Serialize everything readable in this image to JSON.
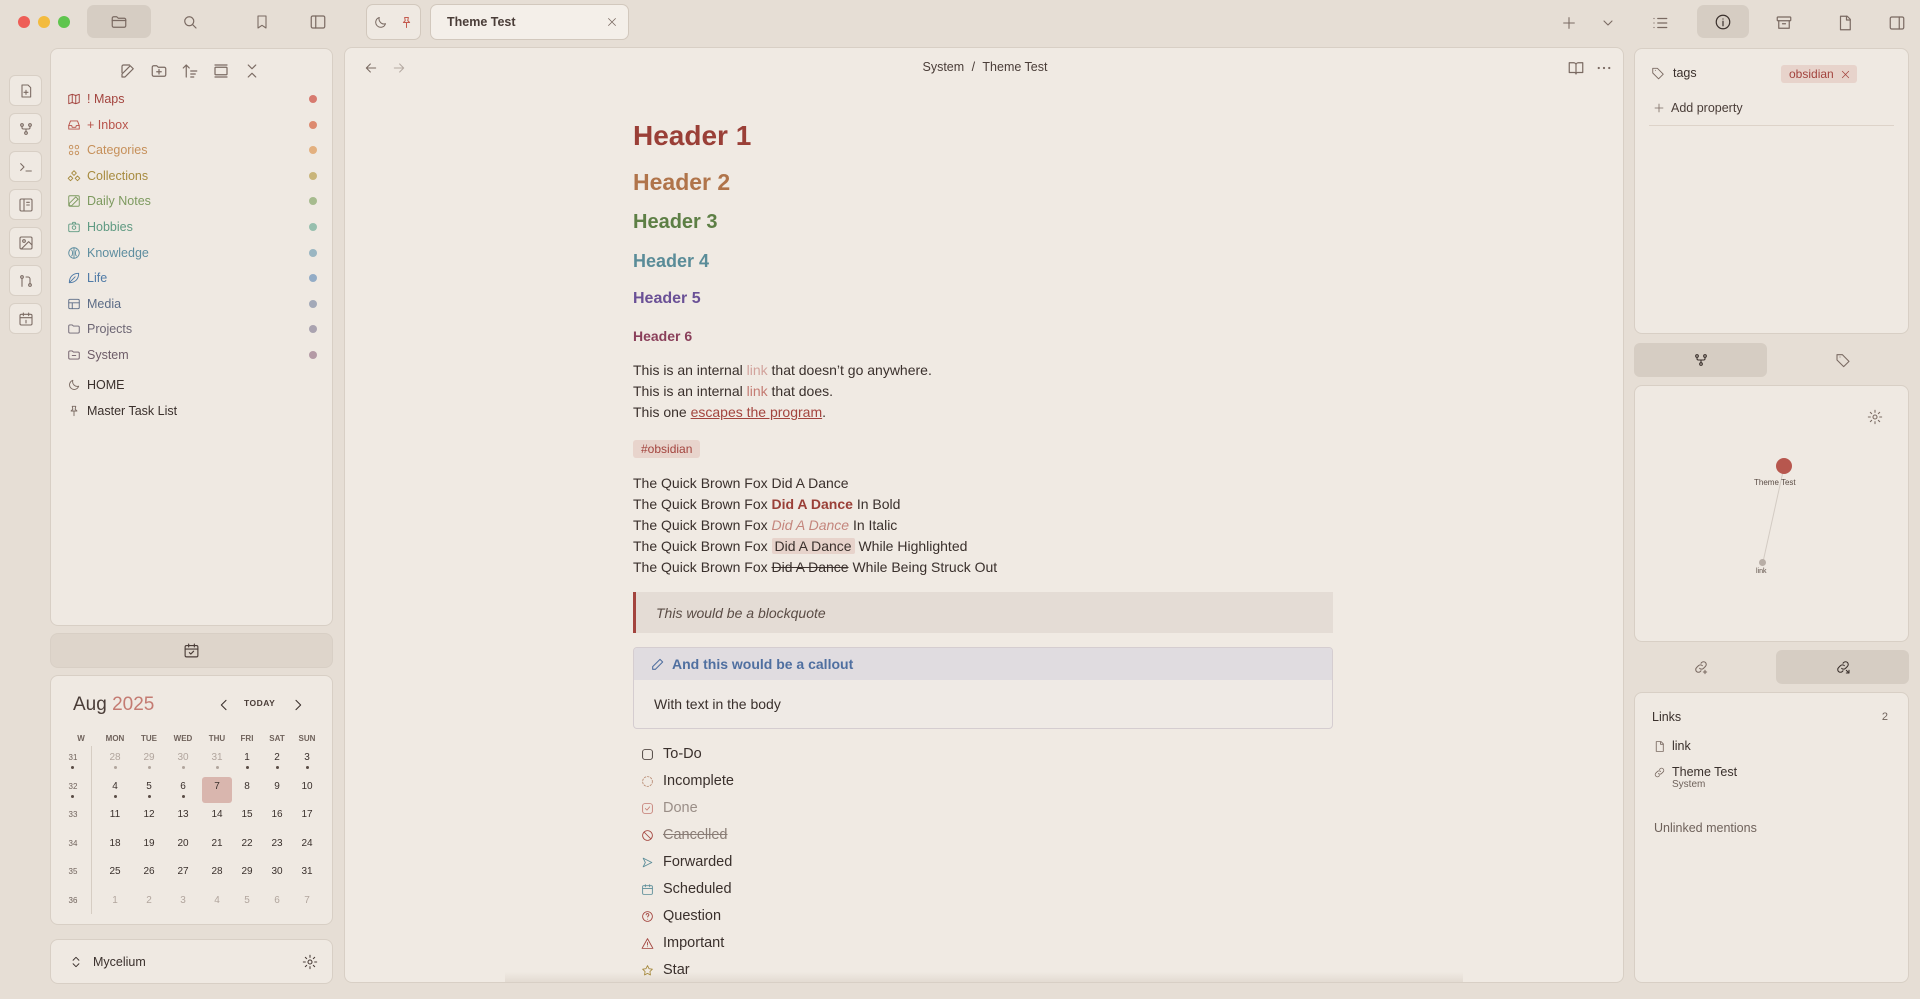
{
  "titlebar": {
    "tab_title": "Theme Test"
  },
  "left_sidebar": {
    "folders": [
      {
        "label": "! Maps",
        "color": "#a3443e",
        "dot": "#d77a6f"
      },
      {
        "label": "+ Inbox",
        "color": "#b8534a",
        "dot": "#dd8a6f"
      },
      {
        "label": "Categories",
        "color": "#c6905a",
        "dot": "#e3b07f"
      },
      {
        "label": "Collections",
        "color": "#a78b3f",
        "dot": "#c9b57a"
      },
      {
        "label": "Daily Notes",
        "color": "#7d9a5f",
        "dot": "#a6bb8e"
      },
      {
        "label": "Hobbies",
        "color": "#5f9a82",
        "dot": "#97bfae"
      },
      {
        "label": "Knowledge",
        "color": "#5d8d9f",
        "dot": "#9ab6c2"
      },
      {
        "label": "Life",
        "color": "#4f7aa6",
        "dot": "#93acc6"
      },
      {
        "label": "Media",
        "color": "#5c6c86",
        "dot": "#a3a9b8"
      },
      {
        "label": "Projects",
        "color": "#6d6674",
        "dot": "#aaa3b0"
      },
      {
        "label": "System",
        "color": "#6e5c68",
        "dot": "#b49aa5"
      }
    ],
    "files": [
      {
        "label": "HOME"
      },
      {
        "label": "Master Task List"
      }
    ],
    "vault_name": "Mycelium"
  },
  "calendar": {
    "month": "Aug",
    "year": "2025",
    "today_label": "TODAY",
    "headers": [
      "W",
      "MON",
      "TUE",
      "WED",
      "THU",
      "FRI",
      "SAT",
      "SUN"
    ],
    "weeks": [
      {
        "w": "31",
        "days": [
          "28",
          "29",
          "30",
          "31",
          "1",
          "2",
          "3"
        ]
      },
      {
        "w": "32",
        "days": [
          "4",
          "5",
          "6",
          "7",
          "8",
          "9",
          "10"
        ]
      },
      {
        "w": "33",
        "days": [
          "11",
          "12",
          "13",
          "14",
          "15",
          "16",
          "17"
        ]
      },
      {
        "w": "34",
        "days": [
          "18",
          "19",
          "20",
          "21",
          "22",
          "23",
          "24"
        ]
      },
      {
        "w": "35",
        "days": [
          "25",
          "26",
          "27",
          "28",
          "29",
          "30",
          "31"
        ]
      },
      {
        "w": "36",
        "days": [
          "1",
          "2",
          "3",
          "4",
          "5",
          "6",
          "7"
        ]
      }
    ]
  },
  "editor": {
    "breadcrumb_parent": "System",
    "breadcrumb_sep": "/",
    "breadcrumb_current": "Theme Test",
    "headers": [
      {
        "text": "Header 1",
        "color": "#9a3f37",
        "size": 28
      },
      {
        "text": "Header 2",
        "color": "#b0744a",
        "size": 23
      },
      {
        "text": "Header 3",
        "color": "#5d7f45",
        "size": 20
      },
      {
        "text": "Header 4",
        "color": "#5a8c98",
        "size": 18
      },
      {
        "text": "Header 5",
        "color": "#6a5096",
        "size": 16
      },
      {
        "text": "Header 6",
        "color": "#8a3f5a",
        "size": 14
      }
    ],
    "line1": {
      "pre": "This is an internal ",
      "link": "link",
      "post": " that doesn’t go anywhere."
    },
    "line2": {
      "pre": "This is an internal ",
      "link": "link",
      "post": " that does."
    },
    "line3": {
      "pre": "This one ",
      "link": "escapes the program",
      "post": "."
    },
    "tag": "#obsidian",
    "fox_pre": "The Quick Brown Fox ",
    "fox_dance": "Did A Dance",
    "fox1_post": "",
    "fox2_post": " In Bold",
    "fox3_post": " In Italic",
    "fox4_post": " While Highlighted",
    "fox5_post": " While Being Struck Out",
    "blockquote": "This would be a blockquote",
    "callout_title": "And this would be a callout",
    "callout_body": "With text in the body",
    "tasks": [
      "To-Do",
      "Incomplete",
      "Done",
      "Cancelled",
      "Forwarded",
      "Scheduled",
      "Question",
      "Important",
      "Star"
    ]
  },
  "right_sidebar": {
    "property_name": "tags",
    "property_value": "obsidian",
    "add_property": "Add property",
    "graph_node_main": "Theme Test",
    "graph_node_link": "link",
    "links_title": "Links",
    "links_count": "2",
    "link1": "link",
    "link2": "Theme Test",
    "link2_sub": "System",
    "unlinked": "Unlinked mentions"
  }
}
